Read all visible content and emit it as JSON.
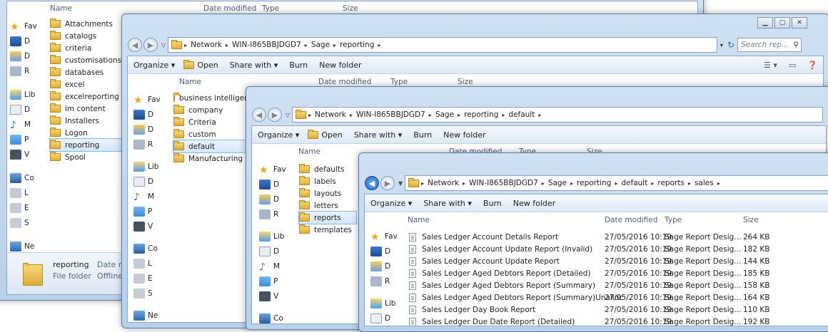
{
  "common": {
    "organize": "Organize ▾",
    "open": "Open",
    "share_with": "Share with ▾",
    "burn": "Burn",
    "new_folder": "New folder",
    "col_name": "Name",
    "col_date": "Date modified",
    "col_type": "Type",
    "col_size": "Size"
  },
  "nav_abbrev": {
    "favorites": "Fav",
    "desktop": "D",
    "downloads": "D",
    "recent": "R",
    "libraries": "Lib",
    "documents": "D",
    "music": "M",
    "pictures": "P",
    "videos": "V",
    "computer": "Co",
    "local": "L",
    "e_drive": "E",
    "s_drive": "S",
    "network": "Ne"
  },
  "win1": {
    "folders": [
      "Attachments",
      "catalogs",
      "criteria",
      "customisations",
      "databases",
      "excel",
      "excelreporting",
      "im content",
      "Installers",
      "Logon",
      "reporting",
      "Spool"
    ],
    "selected_index": 10,
    "status_name": "reporting",
    "status_date_label": "Date m",
    "status_type": "File folder",
    "status_offline": "Offline ava"
  },
  "win2": {
    "crumbs": [
      "Network",
      "WIN-I865BBJDGD7",
      "Sage",
      "reporting"
    ],
    "search_placeholder": "Search rep...",
    "folders": [
      "business intelligence",
      "company",
      "Criteria",
      "custom",
      "default",
      "Manufacturing"
    ],
    "selected_index": 4
  },
  "win3": {
    "crumbs": [
      "Network",
      "WIN-I865BBJDGD7",
      "Sage",
      "reporting",
      "default"
    ],
    "folders": [
      "defaults",
      "labels",
      "layouts",
      "letters",
      "reports",
      "templates"
    ],
    "selected_index": 4
  },
  "win4": {
    "crumbs": [
      "Network",
      "WIN-I865BBJDGD7",
      "Sage",
      "reporting",
      "default",
      "reports",
      "sales"
    ],
    "files": [
      {
        "name": "Sales Ledger Account Details Report",
        "date": "27/05/2016 10:19",
        "type": "Sage Report Desig...",
        "size": "264 KB"
      },
      {
        "name": "Sales Ledger Account Update Report (Invalid)",
        "date": "27/05/2016 10:19",
        "type": "Sage Report Desig...",
        "size": "182 KB"
      },
      {
        "name": "Sales Ledger Account Update Report",
        "date": "27/05/2016 10:19",
        "type": "Sage Report Desig...",
        "size": "144 KB"
      },
      {
        "name": "Sales Ledger Aged Debtors Report (Detailed)",
        "date": "27/05/2016 10:19",
        "type": "Sage Report Desig...",
        "size": "185 KB"
      },
      {
        "name": "Sales Ledger Aged Debtors Report (Summary)",
        "date": "27/05/2016 10:19",
        "type": "Sage Report Desig...",
        "size": "158 KB"
      },
      {
        "name": "Sales Ledger Aged Debtors Report (Summary)Unalloc",
        "date": "27/05/2016 10:19",
        "type": "Sage Report Desig...",
        "size": "164 KB"
      },
      {
        "name": "Sales Ledger Day Book Report",
        "date": "27/05/2016 10:19",
        "type": "Sage Report Desig...",
        "size": "110 KB"
      },
      {
        "name": "Sales Ledger Due Date Report (Detailed)",
        "date": "27/05/2016 10:19",
        "type": "Sage Report Desig...",
        "size": "192 KB"
      }
    ]
  }
}
